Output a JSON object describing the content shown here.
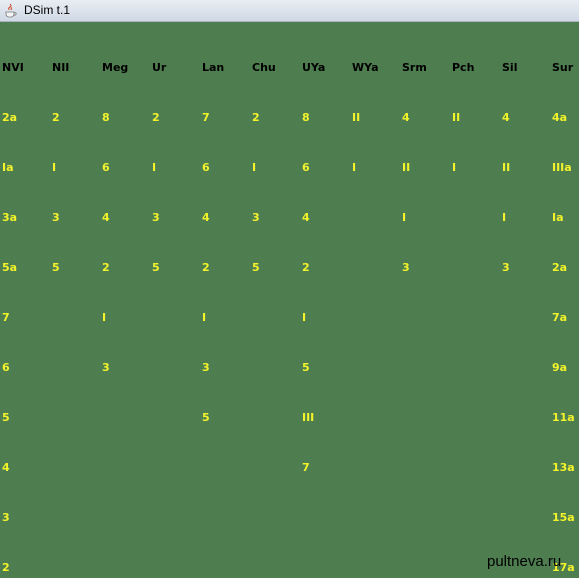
{
  "window": {
    "title": "DSim t.1",
    "icon": "java-app-icon"
  },
  "colors": {
    "background": "#4e7e4f",
    "header_text": "#000000",
    "value_text": "#f3f32b"
  },
  "table": {
    "headers": [
      "NVI",
      "NII",
      "Meg",
      "Ur",
      "Lan",
      "Chu",
      "UYa",
      "WYa",
      "Srm",
      "Pch",
      "Sil",
      "Sur"
    ],
    "rows": [
      [
        "2a",
        "2",
        "8",
        "2",
        "7",
        "2",
        "8",
        "II",
        "4",
        "II",
        "4",
        "4a"
      ],
      [
        "Ia",
        "I",
        "6",
        "I",
        "6",
        "I",
        "6",
        "I",
        "II",
        "I",
        "II",
        "IIIa"
      ],
      [
        "3a",
        "3",
        "4",
        "3",
        "4",
        "3",
        "4",
        "",
        "I",
        "",
        "I",
        "Ia"
      ],
      [
        "5a",
        "5",
        "2",
        "5",
        "2",
        "5",
        "2",
        "",
        "3",
        "",
        "3",
        "2a"
      ],
      [
        "7",
        "",
        "I",
        "",
        "I",
        "",
        "I",
        "",
        "",
        "",
        "",
        "7a"
      ],
      [
        "6",
        "",
        "3",
        "",
        "3",
        "",
        "5",
        "",
        "",
        "",
        "",
        "9a"
      ],
      [
        "5",
        "",
        "",
        "",
        "5",
        "",
        "III",
        "",
        "",
        "",
        "",
        "11a"
      ],
      [
        "4",
        "",
        "",
        "",
        "",
        "",
        "7",
        "",
        "",
        "",
        "",
        "13a"
      ],
      [
        "3",
        "",
        "",
        "",
        "",
        "",
        "",
        "",
        "",
        "",
        "",
        "15a"
      ],
      [
        "2",
        "",
        "",
        "",
        "",
        "",
        "",
        "",
        "",
        "",
        "",
        "17a"
      ]
    ]
  },
  "watermark": "pultneva.ru"
}
